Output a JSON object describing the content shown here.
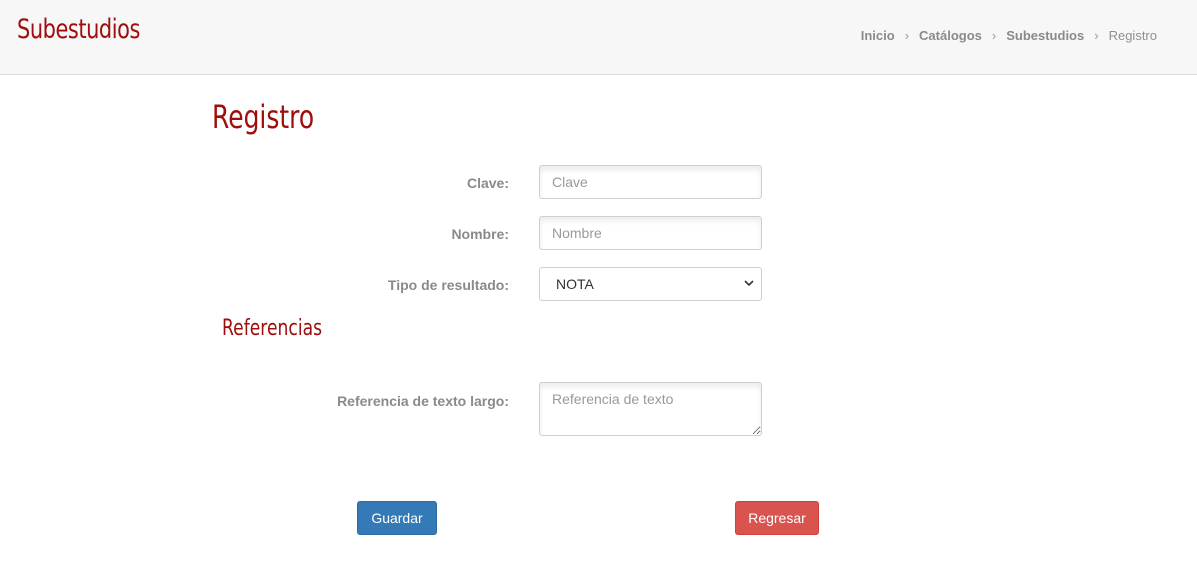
{
  "header": {
    "app_title": "Subestudios",
    "breadcrumb": {
      "items": [
        "Inicio",
        "Catálogos",
        "Subestudios"
      ],
      "current": "Registro",
      "separator": "›"
    }
  },
  "page": {
    "title": "Registro"
  },
  "form": {
    "clave": {
      "label": "Clave:",
      "placeholder": "Clave",
      "value": ""
    },
    "nombre": {
      "label": "Nombre:",
      "placeholder": "Nombre",
      "value": ""
    },
    "tipo_resultado": {
      "label": "Tipo de resultado:",
      "selected": "NOTA"
    },
    "references_title": "Referencias",
    "referencia_texto": {
      "label": "Referencia de texto largo:",
      "placeholder": "Referencia de texto",
      "value": ""
    }
  },
  "actions": {
    "save_label": "Guardar",
    "back_label": "Regresar"
  },
  "colors": {
    "accent": "#a00d0d",
    "primary_button": "#337ab7",
    "danger_button": "#d9534f"
  }
}
